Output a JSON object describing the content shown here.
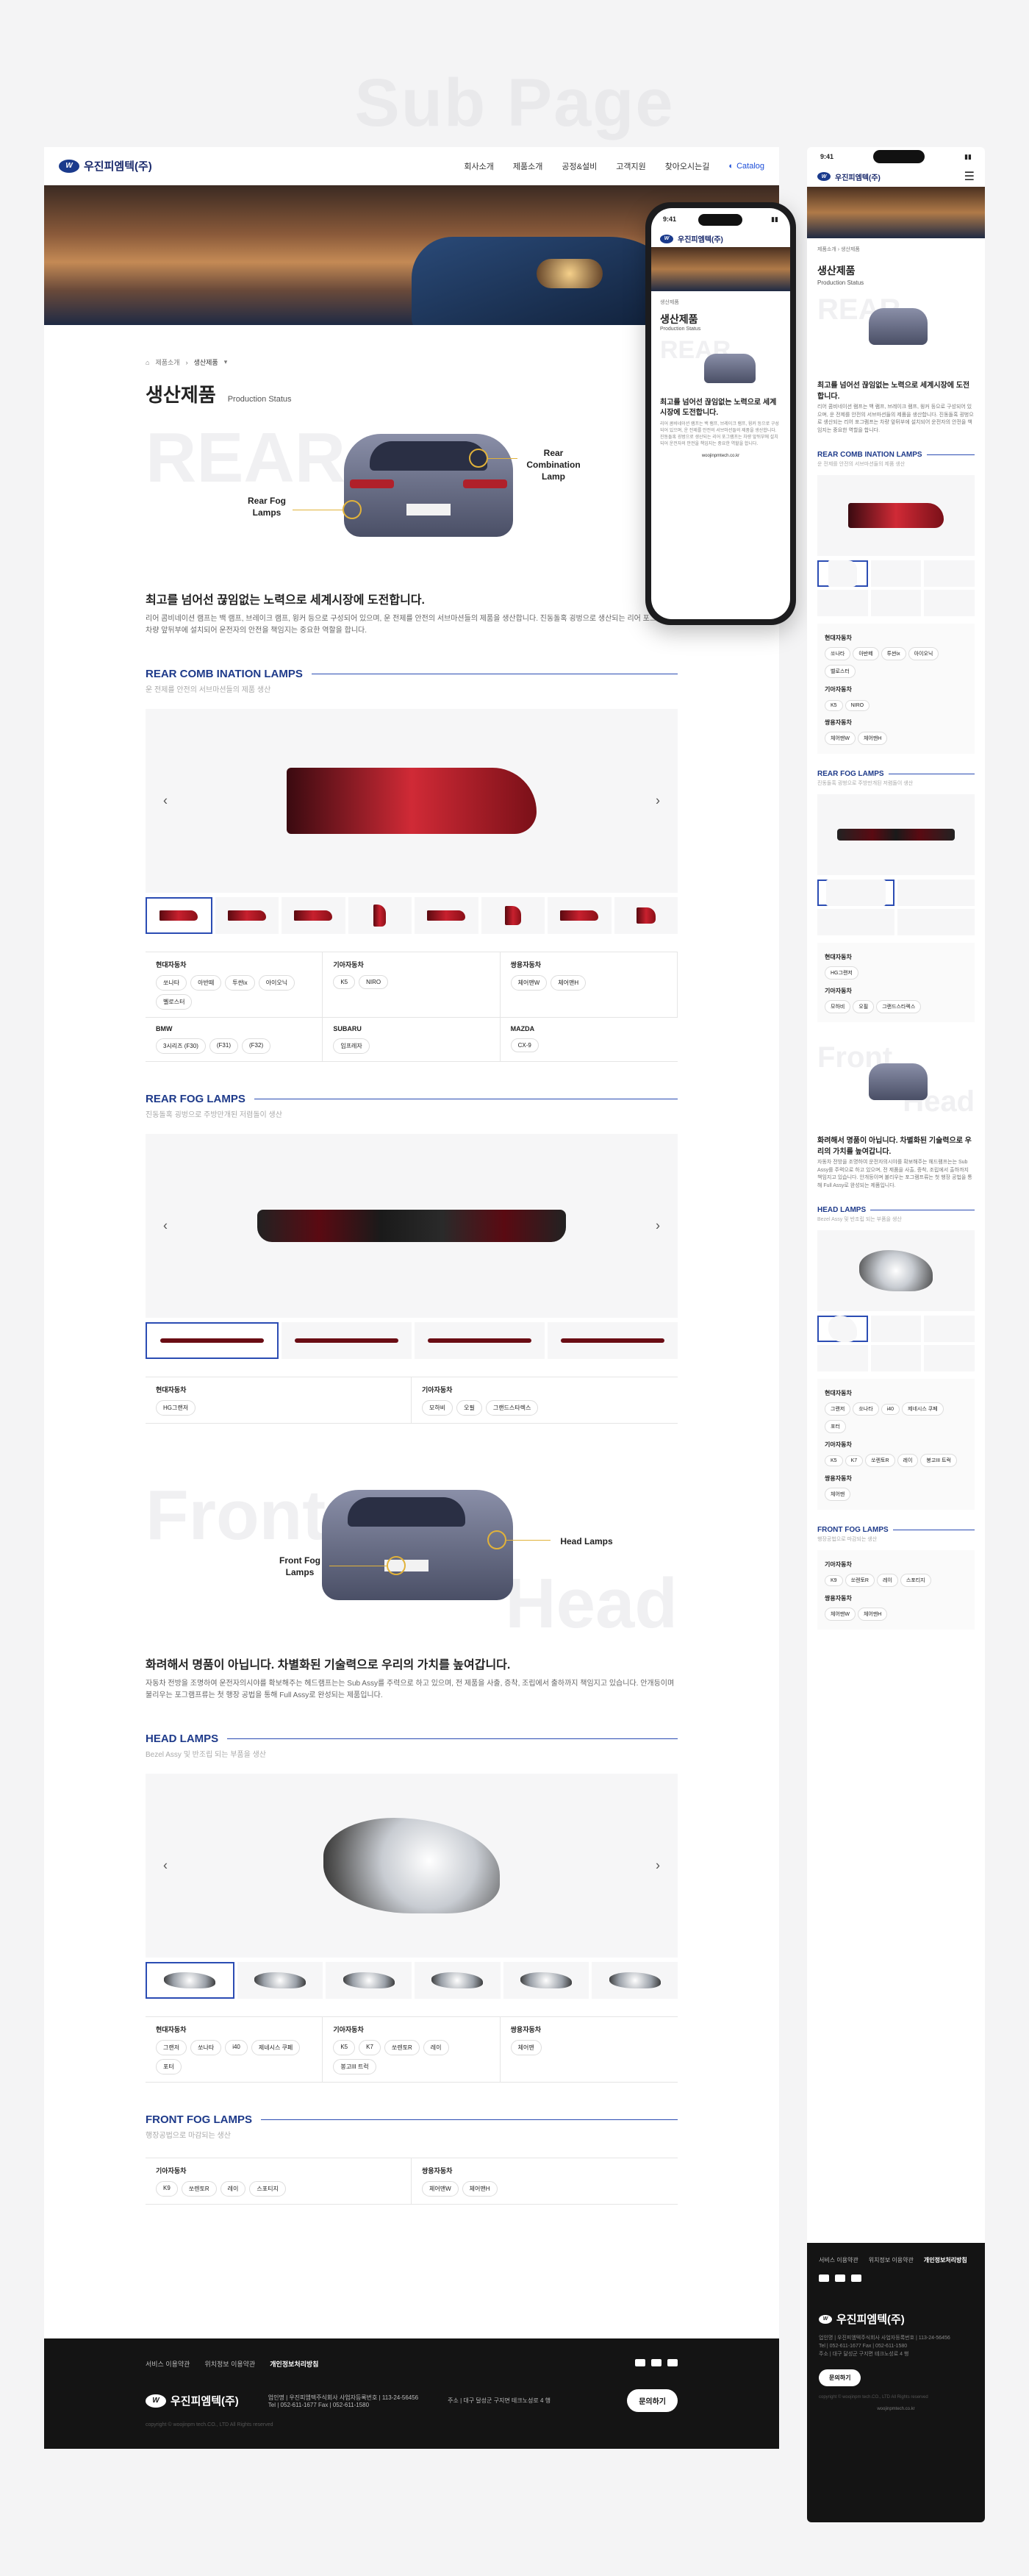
{
  "page_title": "Sub Page",
  "brand": {
    "name": "우진피엠텍(주)",
    "mark": "W"
  },
  "nav": {
    "items": [
      "회사소개",
      "제품소개",
      "공정&설비",
      "고객지원",
      "찾아오시는길"
    ],
    "catalog": "Catalog"
  },
  "breadcrumb": {
    "home": "⌂",
    "level1": "제품소개",
    "level2": "생산제품"
  },
  "heading": {
    "title": "생산제품",
    "subtitle": "Production Status"
  },
  "rear_feature": {
    "bgword": "REAR",
    "callout_left": "Rear Fog Lamps",
    "callout_right": "Rear Combination Lamp",
    "headline": "최고를 넘어선 끊임없는 노력으로 세계시장에 도전합니다.",
    "desc": "리어 콤비네이션 램프는 백 램프, 브레이크 램프, 윙커 등으로 구성되어 있으며, 운 전제를 안전의 서브마션들의 제품을 생산합니다. 진동돌혹 굉벙으로 생산되는 리어 포그램프는 차량 앞뒤부에 설치되어 운전자의 안전을 책임지는 중요한 역할을 합니다."
  },
  "sections": {
    "rear_comb": {
      "title": "REAR COMB INATION LAMPS",
      "sub": "운 전제를 안전의 서브마션들의 제품 생산",
      "specs": [
        {
          "name": "현대자동차",
          "tags": [
            "쏘나타",
            "아반떼",
            "투싼ix",
            "아이오닉",
            "벨로스터"
          ]
        },
        {
          "name": "기아자동차",
          "tags": [
            "K5",
            "NIRO"
          ]
        },
        {
          "name": "쌍용자동차",
          "tags": [
            "체어맨W",
            "체어맨H"
          ]
        },
        {
          "name": "BMW",
          "tags": [
            "3시리즈 (F30)",
            "(F31)",
            "(F32)"
          ]
        },
        {
          "name": "SUBARU",
          "tags": [
            "임프레자"
          ]
        },
        {
          "name": "MAZDA",
          "tags": [
            "CX-9"
          ]
        }
      ]
    },
    "rear_fog": {
      "title": "REAR FOG LAMPS",
      "sub": "진동돌혹 굉벙으로 주방만개된 저렴돌이 생산",
      "specs": [
        {
          "name": "현대자동차",
          "tags": [
            "HG그랜저"
          ]
        },
        {
          "name": "기아자동차",
          "tags": [
            "모하비",
            "오필",
            "그랜드스타렉스"
          ]
        }
      ]
    },
    "front_feature": {
      "bgword1": "Front",
      "bgword2": "Head",
      "callout_left": "Front Fog Lamps",
      "callout_right": "Head Lamps",
      "headline": "화려해서 명품이 아닙니다. 차별화된 기술력으로 우리의 가치를 높여갑니다.",
      "desc": "자동차 전방을 조명하여 운전자의시야를 확보해주는 헤드램프는는 Sub Assy를 주력으로 하고 있으며, 전 제품을 사출, 증착, 조립에서 출하까지 책임지고 있습니다. 안개등이며 불리우는 포그램프류는 첫 행장 공법을 통해 Full Assy로 완성되는 제품입니다."
    },
    "head": {
      "title": "HEAD LAMPS",
      "sub": "Bezel Assy 및 반조립 되는 부품을 생산",
      "specs": [
        {
          "name": "현대자동차",
          "tags": [
            "그랜저",
            "쏘나타",
            "i40",
            "제네시스 쿠페",
            "포터"
          ]
        },
        {
          "name": "기아자동차",
          "tags": [
            "K5",
            "K7",
            "쏘렌토R",
            "레이",
            "봉고III 트럭"
          ]
        },
        {
          "name": "쌍용자동차",
          "tags": [
            "체어맨"
          ]
        }
      ]
    },
    "front_fog": {
      "title": "FRONT FOG LAMPS",
      "sub": "행장공법으로 마감되는 생산",
      "specs": [
        {
          "name": "기아자동차",
          "tags": [
            "K9",
            "쏘렌토R",
            "레이",
            "스포티지"
          ]
        },
        {
          "name": "쌍용자동차",
          "tags": [
            "체어맨W",
            "체어맨H"
          ]
        }
      ]
    }
  },
  "footer": {
    "links": [
      "서비스 이용약관",
      "위치정보 이용약관",
      "개인정보처리방침"
    ],
    "info1": "업인명 | 우진피엠텍주식회사 사업자등록번호 | 113-24-56456",
    "info2": "Tel | 052-611-1677 Fax | 052-611-1580",
    "info3": "주소 | 대구 달성군 구지면 테크노성로 4 행",
    "contact": "문의하기",
    "copyright": "copyright © woojinpm tech.CO., LTD All Rights reserved"
  },
  "mobile": {
    "time": "9:41",
    "url": "woojinpmtech.co.kr"
  },
  "colors": {
    "accent": "#1e3a8a",
    "brand": "#1a3a8c",
    "footer": "#141414"
  }
}
